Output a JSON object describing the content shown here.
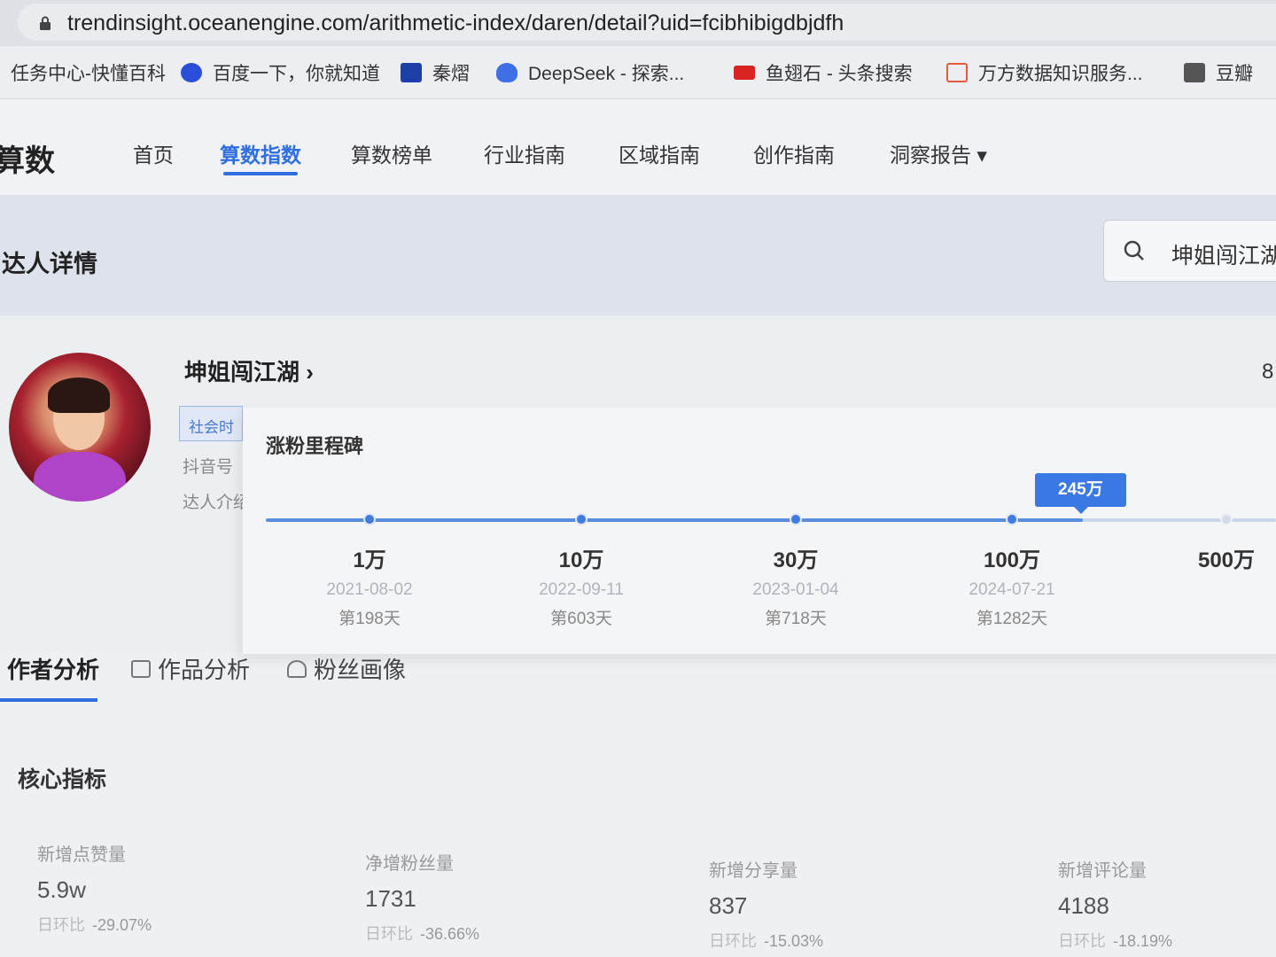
{
  "browser": {
    "url": "trendinsight.oceanengine.com/arithmetic-index/daren/detail?uid=fcibhibigdbjdfh",
    "bookmarks": [
      {
        "label": "任务中心-快懂百科",
        "icon": "none",
        "color": "#eceef1"
      },
      {
        "label": "百度一下，你就知道",
        "icon": "paw-icon",
        "color": "#2b4ed8"
      },
      {
        "label": "秦熠",
        "icon": "tv-icon",
        "color": "#1f3fa8"
      },
      {
        "label": "DeepSeek - 探索...",
        "icon": "whale-icon",
        "color": "#3e6fe6"
      },
      {
        "label": "鱼翅石 - 头条搜索",
        "icon": "flag-icon",
        "color": "#d92222"
      },
      {
        "label": "万方数据知识服务...",
        "icon": "book-icon",
        "color": "#e25a3a"
      },
      {
        "label": "豆瓣",
        "icon": "grid-icon",
        "color": "#555555"
      }
    ]
  },
  "nav": {
    "logo": "算数",
    "items": [
      "首页",
      "算数指数",
      "算数榜单",
      "行业指南",
      "区域指南",
      "创作指南",
      "洞察报告 ▾"
    ],
    "active_index": 1
  },
  "banner": {
    "title": "达人详情",
    "search_value": "坤姐闯江湖"
  },
  "profile": {
    "name": "坤姐闯江湖",
    "name_suffix": "›",
    "tag": "社会时",
    "meta1": "抖音号",
    "meta2": "达人介绍",
    "right_edge": "8"
  },
  "milestone": {
    "title": "涨粉里程碑",
    "current_label": "245万",
    "points": [
      {
        "value": "1万",
        "date": "2021-08-02",
        "day": "第198天"
      },
      {
        "value": "10万",
        "date": "2022-09-11",
        "day": "第603天"
      },
      {
        "value": "30万",
        "date": "2023-01-04",
        "day": "第718天"
      },
      {
        "value": "100万",
        "date": "2024-07-21",
        "day": "第1282天"
      },
      {
        "value": "500万",
        "date": "",
        "day": ""
      }
    ]
  },
  "tabs": [
    "作者分析",
    "作品分析",
    "粉丝画像"
  ],
  "core": {
    "title": "核心指标",
    "metrics": [
      {
        "label": "新增点赞量",
        "value": "5.9w",
        "change_label": "日环比",
        "change": "-29.07%"
      },
      {
        "label": "净增粉丝量",
        "value": "1731",
        "change_label": "日环比",
        "change": "-36.66%"
      },
      {
        "label": "新增分享量",
        "value": "837",
        "change_label": "日环比",
        "change": "-15.03%"
      },
      {
        "label": "新增评论量",
        "value": "4188",
        "change_label": "日环比",
        "change": "-18.19%"
      }
    ]
  },
  "colors": {
    "accent": "#2f6fe0",
    "milestone_fill": "#5a8fe0",
    "badge": "#3a78e3"
  }
}
